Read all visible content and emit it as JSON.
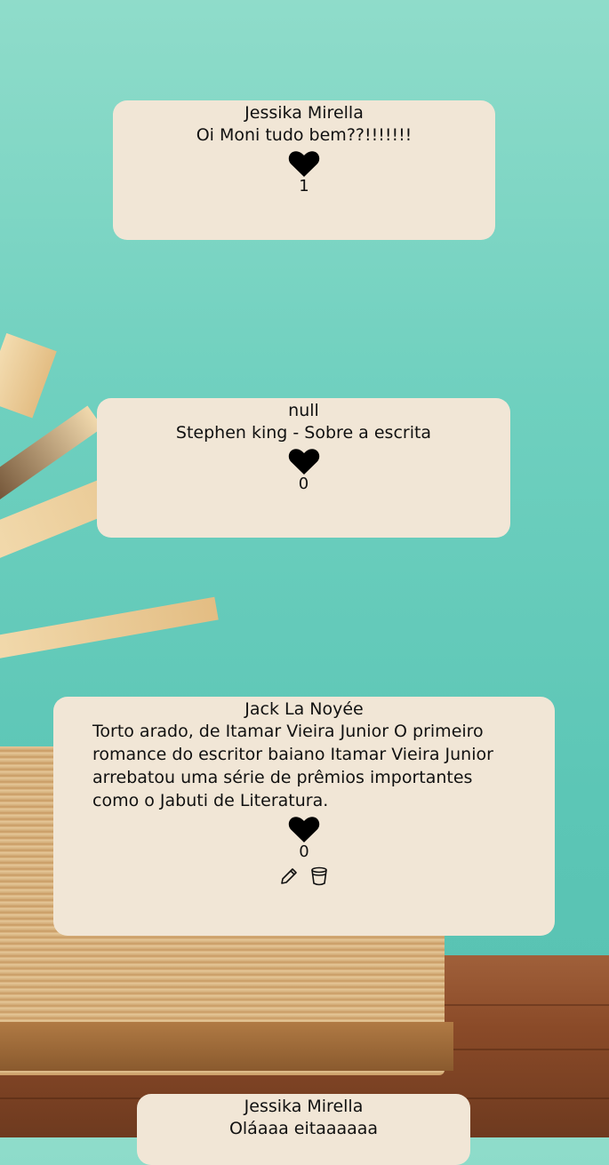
{
  "posts": [
    {
      "author": "Jessika Mirella",
      "content": "Oi Moni tudo bem??!!!!!!!",
      "likes": "1"
    },
    {
      "author": "null",
      "content": "Stephen king - Sobre a escrita",
      "likes": "0"
    },
    {
      "author": "Jack La Noyée",
      "content": "Torto arado, de Itamar Vieira Junior O primeiro romance do escritor baiano Itamar Vieira Junior arrebatou uma série de prêmios importantes como o Jabuti de Literatura.",
      "likes": "0",
      "actions": [
        "pencil-icon",
        "trash-icon"
      ]
    },
    {
      "author": "Jessika Mirella",
      "content": "Oláaaa eitaaaaaa"
    }
  ],
  "colors": {
    "card_bg": "#f1e6d6",
    "background": "#6fd0bf",
    "heart": "#000000"
  }
}
